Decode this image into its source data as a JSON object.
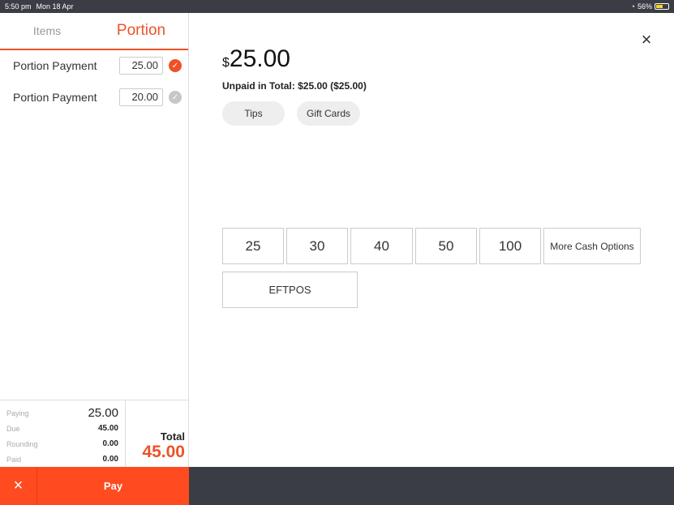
{
  "status_bar": {
    "time": "5:50 pm",
    "date": "Mon 18 Apr",
    "battery": "56%",
    "battery_level": 0.56
  },
  "tabs": [
    {
      "label": "Items",
      "active": false
    },
    {
      "label": "Portion",
      "active": true
    }
  ],
  "portions": [
    {
      "label": "Portion Payment",
      "amount": "25.00",
      "selected": true
    },
    {
      "label": "Portion Payment",
      "amount": "20.00",
      "selected": false
    }
  ],
  "summary": {
    "paying_label": "Paying",
    "paying": "25.00",
    "due_label": "Due",
    "due": "45.00",
    "rounding_label": "Rounding",
    "rounding": "0.00",
    "paid_label": "Paid",
    "paid": "0.00",
    "total_label": "Total",
    "total": "45.00"
  },
  "actions": {
    "pay_label": "Pay",
    "cancel_icon": "×"
  },
  "payment": {
    "currency": "$",
    "amount": "25.00",
    "unpaid_text": "Unpaid in Total: $25.00 ($25.00)",
    "tips_label": "Tips",
    "gift_cards_label": "Gift Cards",
    "cash_options": [
      "25",
      "30",
      "40",
      "50",
      "100"
    ],
    "more_cash_label": "More Cash Options",
    "eftpos_label": "EFTPOS",
    "close_icon": "×"
  },
  "colors": {
    "accent": "#ee5128",
    "pay_button": "#ff4b1f",
    "dark_bar": "#3a3d44"
  }
}
